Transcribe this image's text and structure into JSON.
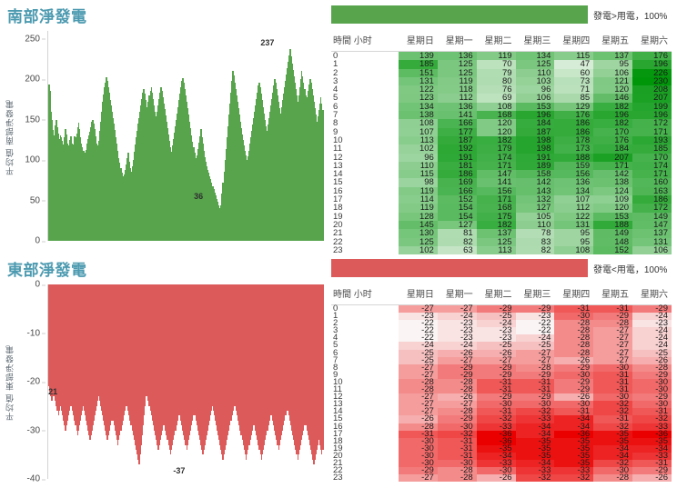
{
  "panels": [
    {
      "id": "south",
      "title": "南部淨發電",
      "accent_color": "#57a44c",
      "legend": {
        "text": "發電>用電，100%",
        "swatch_color": "#57a44c"
      },
      "axis": {
        "ylabel": "平均值 南部淨發電",
        "ticks": [
          "250",
          "200",
          "150",
          "100",
          "50",
          "0"
        ],
        "ymin": 0,
        "ymax": 260
      },
      "annotations": [
        {
          "label": "237",
          "x_frac": 0.795,
          "value": 237
        },
        {
          "label": "36",
          "x_frac": 0.545,
          "value": 36
        }
      ],
      "table": {
        "columns": [
          "時間 小时",
          "星期日",
          "星期一",
          "星期二",
          "星期三",
          "星期四",
          "星期五",
          "星期六"
        ],
        "rows": [
          [
            "0",
            139,
            136,
            119,
            134,
            115,
            137,
            176
          ],
          [
            "1",
            185,
            125,
            70,
            125,
            47,
            95,
            196
          ],
          [
            "2",
            151,
            125,
            79,
            110,
            60,
            106,
            226
          ],
          [
            "3",
            131,
            119,
            80,
            103,
            73,
            121,
            230
          ],
          [
            "4",
            122,
            118,
            76,
            96,
            71,
            120,
            208
          ],
          [
            "5",
            123,
            112,
            69,
            106,
            85,
            146,
            207
          ],
          [
            "6",
            134,
            136,
            108,
            153,
            129,
            182,
            199
          ],
          [
            "7",
            138,
            141,
            168,
            196,
            176,
            196,
            196
          ],
          [
            "8",
            108,
            166,
            120,
            184,
            186,
            182,
            172
          ],
          [
            "9",
            107,
            177,
            120,
            187,
            186,
            170,
            171
          ],
          [
            "10",
            113,
            187,
            182,
            198,
            178,
            176,
            193
          ],
          [
            "11",
            102,
            192,
            179,
            198,
            173,
            184,
            185
          ],
          [
            "12",
            96,
            191,
            174,
            191,
            188,
            207,
            170
          ],
          [
            "13",
            110,
            181,
            171,
            189,
            159,
            171,
            174
          ],
          [
            "14",
            115,
            186,
            147,
            158,
            156,
            142,
            171
          ],
          [
            "15",
            98,
            169,
            141,
            142,
            136,
            138,
            160
          ],
          [
            "16",
            119,
            166,
            156,
            143,
            134,
            124,
            163
          ],
          [
            "17",
            114,
            152,
            171,
            132,
            107,
            109,
            186
          ],
          [
            "18",
            119,
            154,
            168,
            127,
            112,
            120,
            172
          ],
          [
            "19",
            128,
            154,
            175,
            105,
            122,
            153,
            149
          ],
          [
            "20",
            145,
            127,
            182,
            110,
            131,
            188,
            147
          ],
          [
            "21",
            130,
            81,
            137,
            78,
            95,
            149,
            137
          ],
          [
            "22",
            125,
            82,
            125,
            83,
            95,
            148,
            131
          ],
          [
            "23",
            102,
            63,
            113,
            82,
            108,
            152,
            106
          ]
        ],
        "scale": {
          "min": 47,
          "max": 230
        }
      }
    },
    {
      "id": "east",
      "title": "東部淨發電",
      "accent_color": "#dc5a5a",
      "legend": {
        "text": "發電<用電，100%",
        "swatch_color": "#dc5a5a"
      },
      "axis": {
        "ylabel": "平均值 東部淨發電",
        "ticks": [
          "0",
          "-10",
          "-20",
          "-30",
          "-40"
        ],
        "ymin": -40,
        "ymax": 0
      },
      "annotations": [
        {
          "label": "-21",
          "x_frac": 0.012,
          "value": -21
        },
        {
          "label": "-37",
          "x_frac": 0.475,
          "value": -37
        }
      ],
      "table": {
        "columns": [
          "時間 小时",
          "星期日",
          "星期一",
          "星期二",
          "星期三",
          "星期四",
          "星期五",
          "星期六"
        ],
        "rows": [
          [
            "0",
            -27,
            -27,
            -29,
            -29,
            -31,
            -31,
            -29
          ],
          [
            "1",
            -23,
            -24,
            -25,
            -23,
            -30,
            -29,
            -24
          ],
          [
            "2",
            -22,
            -23,
            -24,
            -22,
            -28,
            -28,
            -23
          ],
          [
            "3",
            -22,
            -23,
            -23,
            -22,
            -28,
            -27,
            -24
          ],
          [
            "4",
            -22,
            -23,
            -23,
            -24,
            -28,
            -27,
            -24
          ],
          [
            "5",
            -24,
            -24,
            -25,
            -25,
            -28,
            -27,
            -24
          ],
          [
            "6",
            -25,
            -26,
            -26,
            -27,
            -28,
            -27,
            -25
          ],
          [
            "7",
            -25,
            -27,
            -27,
            -27,
            -26,
            -27,
            -26
          ],
          [
            "8",
            -27,
            -29,
            -29,
            -28,
            -29,
            -30,
            -28
          ],
          [
            "9",
            -27,
            -29,
            -29,
            -29,
            -30,
            -31,
            -29
          ],
          [
            "10",
            -28,
            -28,
            -31,
            -31,
            -29,
            -31,
            -30
          ],
          [
            "11",
            -28,
            -28,
            -31,
            -31,
            -29,
            -31,
            -30
          ],
          [
            "12",
            -27,
            -26,
            -29,
            -29,
            -26,
            -30,
            -29
          ],
          [
            "13",
            -27,
            -27,
            -30,
            -30,
            -30,
            -32,
            -30
          ],
          [
            "14",
            -27,
            -28,
            -31,
            -32,
            -31,
            -32,
            -31
          ],
          [
            "15",
            -26,
            -29,
            -32,
            -33,
            -34,
            -31,
            -32
          ],
          [
            "16",
            -28,
            -30,
            -33,
            -34,
            -34,
            -32,
            -33
          ],
          [
            "17",
            -31,
            -32,
            -36,
            -34,
            -36,
            -35,
            -36
          ],
          [
            "18",
            -30,
            -31,
            -36,
            -35,
            -35,
            -35,
            -35
          ],
          [
            "19",
            -30,
            -31,
            -35,
            -35,
            -35,
            -34,
            -34
          ],
          [
            "20",
            -30,
            -31,
            -34,
            -35,
            -35,
            -34,
            -33
          ],
          [
            "21",
            -30,
            -30,
            -33,
            -34,
            -35,
            -32,
            -31
          ],
          [
            "22",
            -29,
            -28,
            -30,
            -33,
            -33,
            -30,
            -29
          ],
          [
            "23",
            -27,
            -28,
            -26,
            -32,
            -32,
            -28,
            -26
          ]
        ],
        "scale": {
          "min": -36,
          "max": -22
        }
      }
    }
  ],
  "chart_data": [
    {
      "type": "bar",
      "title": "南部淨發電",
      "ylabel": "平均值 南部淨發電",
      "xlabel": "",
      "ylim": [
        0,
        260
      ],
      "ytick_labels": [
        "0",
        "50",
        "100",
        "150",
        "200",
        "250"
      ],
      "grid": false,
      "legend": "發電>用電，100%",
      "annotated_points": {
        "max": 237,
        "min": 36
      },
      "values": [
        194,
        186,
        160,
        150,
        137,
        131,
        128,
        143,
        150,
        141,
        133,
        126,
        131,
        128,
        124,
        119,
        128,
        139,
        132,
        121,
        112,
        118,
        125,
        130,
        121,
        115,
        119,
        130,
        128,
        133,
        141,
        146,
        138,
        128,
        121,
        116,
        112,
        109,
        106,
        113,
        120,
        126,
        131,
        135,
        141,
        147,
        150,
        145,
        138,
        130,
        121,
        118,
        124,
        136,
        148,
        160,
        172,
        181,
        190,
        196,
        203,
        198,
        190,
        183,
        175,
        168,
        160,
        152,
        145,
        137,
        128,
        120,
        112,
        103,
        97,
        90,
        84,
        80,
        76,
        82,
        88,
        95,
        102,
        109,
        98,
        90,
        85,
        92,
        100,
        110,
        119,
        128,
        136,
        145,
        152,
        160,
        168,
        176,
        184,
        188,
        182,
        174,
        166,
        158,
        172,
        180,
        186,
        190,
        184,
        176,
        168,
        160,
        154,
        160,
        168,
        176,
        183,
        190,
        186,
        178,
        170,
        163,
        155,
        148,
        140,
        132,
        124,
        116,
        110,
        118,
        126,
        134,
        142,
        150,
        158,
        166,
        174,
        182,
        190,
        198,
        202,
        196,
        188,
        180,
        172,
        164,
        156,
        148,
        140,
        131,
        123,
        116,
        109,
        103,
        98,
        106,
        114,
        122,
        130,
        138,
        128,
        120,
        112,
        104,
        98,
        92,
        88,
        84,
        80,
        76,
        72,
        68,
        64,
        60,
        56,
        52,
        48,
        44,
        40,
        36,
        44,
        58,
        72,
        86,
        100,
        114,
        128,
        142,
        156,
        170,
        184,
        198,
        210,
        205,
        196,
        188,
        180,
        172,
        164,
        156,
        148,
        140,
        132,
        125,
        118,
        112,
        106,
        100,
        105,
        112,
        120,
        128,
        136,
        144,
        152,
        160,
        168,
        176,
        184,
        192,
        196,
        190,
        182,
        174,
        166,
        158,
        150,
        142,
        136,
        144,
        152,
        160,
        168,
        176,
        184,
        192,
        200,
        196,
        188,
        180,
        172,
        164,
        158,
        166,
        174,
        182,
        190,
        198,
        206,
        214,
        222,
        230,
        237,
        228,
        220,
        212,
        204,
        196,
        188,
        180,
        172,
        180,
        190,
        200,
        210,
        204,
        196,
        188,
        180,
        172,
        178,
        186,
        194,
        200,
        196,
        188,
        180,
        172,
        164,
        156,
        148,
        154,
        162,
        170,
        178,
        170,
        162,
        155
      ]
    },
    {
      "type": "bar",
      "title": "東部淨發電",
      "ylabel": "平均值 東部淨發電",
      "xlabel": "",
      "ylim": [
        -40,
        0
      ],
      "ytick_labels": [
        "0",
        "-10",
        "-20",
        "-30",
        "-40"
      ],
      "grid": false,
      "legend": "發電<用電，100%",
      "annotated_points": {
        "max": -21,
        "min": -37
      },
      "values": [
        -21,
        -22,
        -23,
        -24,
        -23,
        -22,
        -23,
        -24,
        -25,
        -26,
        -27,
        -26,
        -25,
        -26,
        -27,
        -28,
        -29,
        -30,
        -29,
        -28,
        -27,
        -26,
        -25,
        -24,
        -25,
        -26,
        -27,
        -28,
        -29,
        -30,
        -31,
        -30,
        -29,
        -28,
        -27,
        -26,
        -25,
        -26,
        -27,
        -28,
        -29,
        -30,
        -31,
        -32,
        -31,
        -30,
        -29,
        -28,
        -27,
        -26,
        -25,
        -24,
        -23,
        -24,
        -25,
        -26,
        -27,
        -28,
        -29,
        -30,
        -31,
        -32,
        -31,
        -30,
        -29,
        -28,
        -27,
        -28,
        -29,
        -30,
        -31,
        -32,
        -33,
        -32,
        -31,
        -30,
        -29,
        -28,
        -27,
        -26,
        -25,
        -24,
        -25,
        -26,
        -27,
        -28,
        -29,
        -30,
        -31,
        -32,
        -33,
        -34,
        -35,
        -36,
        -37,
        -35,
        -33,
        -31,
        -29,
        -27,
        -25,
        -23,
        -22,
        -23,
        -24,
        -25,
        -26,
        -27,
        -28,
        -29,
        -30,
        -31,
        -32,
        -33,
        -34,
        -33,
        -32,
        -31,
        -30,
        -29,
        -28,
        -29,
        -30,
        -31,
        -32,
        -33,
        -34,
        -35,
        -34,
        -33,
        -32,
        -31,
        -30,
        -29,
        -28,
        -27,
        -26,
        -27,
        -28,
        -29,
        -30,
        -31,
        -32,
        -33,
        -34,
        -33,
        -32,
        -31,
        -30,
        -29,
        -28,
        -27,
        -26,
        -27,
        -28,
        -29,
        -30,
        -31,
        -32,
        -33,
        -34,
        -35,
        -34,
        -33,
        -32,
        -31,
        -30,
        -29,
        -28,
        -27,
        -26,
        -25,
        -26,
        -27,
        -28,
        -29,
        -30,
        -31,
        -32,
        -33,
        -34,
        -35,
        -36,
        -35,
        -34,
        -33,
        -32,
        -31,
        -30,
        -29,
        -28,
        -27,
        -26,
        -25,
        -24,
        -25,
        -26,
        -27,
        -28,
        -29,
        -30,
        -31,
        -32,
        -33,
        -34,
        -35,
        -36,
        -35,
        -34,
        -33,
        -32,
        -31,
        -30,
        -29,
        -28,
        -29,
        -30,
        -31,
        -32,
        -33,
        -34,
        -35,
        -36,
        -35,
        -34,
        -33,
        -32,
        -31,
        -30,
        -29,
        -28,
        -27,
        -26,
        -27,
        -28,
        -29,
        -30,
        -31,
        -32,
        -33,
        -34,
        -33,
        -32,
        -31,
        -30,
        -29,
        -28,
        -27,
        -26,
        -25,
        -26,
        -27,
        -28,
        -29,
        -30,
        -31,
        -32,
        -33,
        -34,
        -35,
        -36,
        -35,
        -34,
        -33,
        -32,
        -31,
        -30,
        -29,
        -28,
        -29,
        -30,
        -31,
        -32,
        -33,
        -34,
        -35,
        -36,
        -37,
        -36,
        -35,
        -34,
        -33,
        -32,
        -33,
        -34,
        -35,
        -34,
        -33
      ]
    }
  ]
}
